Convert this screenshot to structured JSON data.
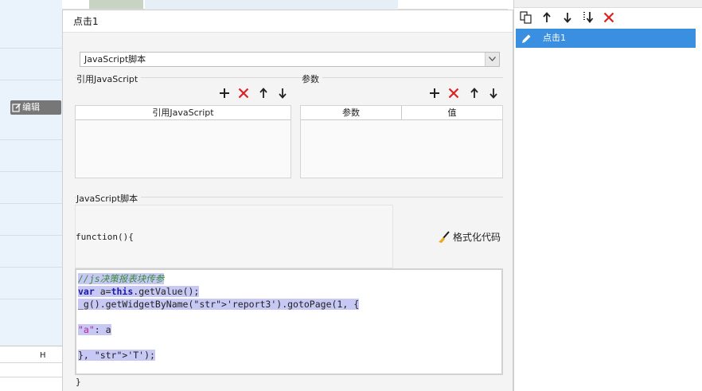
{
  "background": {
    "edit_label": "编辑",
    "column_label": "H"
  },
  "dialog": {
    "title": "点击1",
    "type_select_value": "JavaScript脚本",
    "ref_js_group": "引用JavaScript",
    "params_group": "参数",
    "ref_js_table": {
      "headers": [
        "引用JavaScript"
      ]
    },
    "params_table": {
      "headers": [
        "参数",
        "值"
      ]
    },
    "script_group": "JavaScript脚本",
    "function_open": "function(){",
    "format_button": "格式化代码",
    "code_lines": [
      "//js决策报表块传参",
      "var a=this.getValue();",
      "_g().getWidgetByName('report3').gotoPage(1, {",
      "",
      "\"a\": a",
      "",
      "}, 'T');"
    ],
    "function_close": "}"
  },
  "right_panel": {
    "events": [
      {
        "label": "点击1",
        "selected": true
      }
    ]
  },
  "colors": {
    "accent": "#3b8fe0",
    "delete": "#e02020",
    "selection": "#c8c8f5"
  }
}
